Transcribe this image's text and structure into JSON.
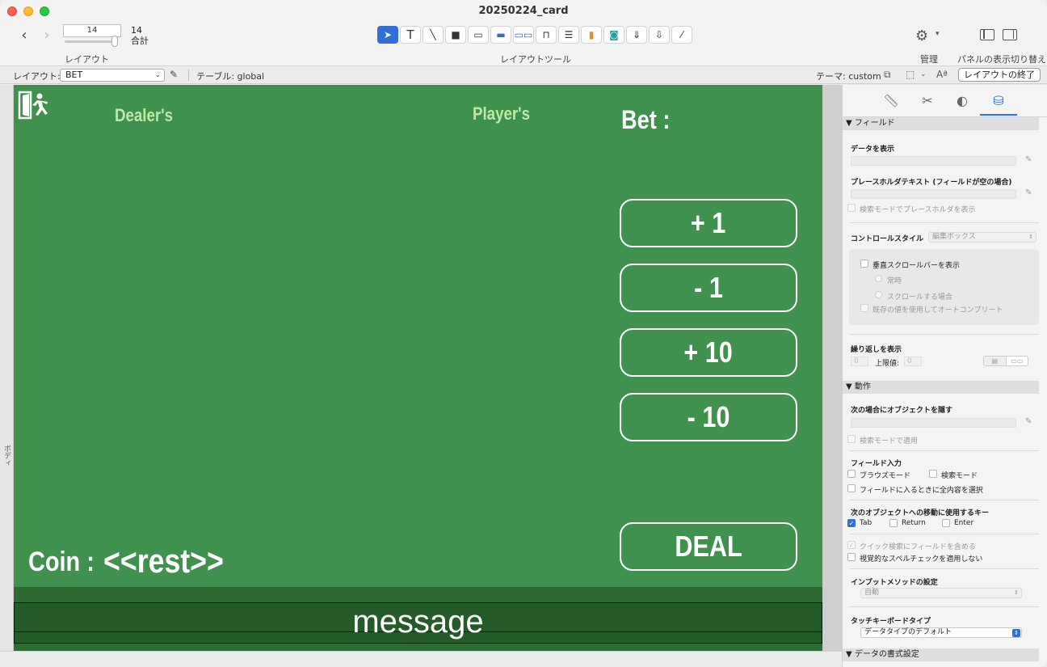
{
  "window": {
    "title": "20250224_card"
  },
  "toolbar": {
    "record_value": "14",
    "record_count": "14",
    "record_total_label": "合計",
    "layout_label": "レイアウト",
    "tools_label": "レイアウトツール",
    "manage_label": "管理",
    "panel_label": "パネルの表示切り替え"
  },
  "layoutbar": {
    "layout_prefix": "レイアウト:",
    "layout_value": "BET",
    "table": "テーブル: global",
    "theme": "テーマ: custom",
    "exit_label": "レイアウトの終了"
  },
  "canvas": {
    "part_label": "ボディ",
    "dealer": "Dealer's",
    "player": "Player's",
    "bet": "Bet :",
    "coin": "Coin :",
    "rest": "<<rest>>",
    "buttons": [
      "+ 1",
      "- 1",
      "+ 10",
      "- 10",
      "DEAL"
    ],
    "message": "message",
    "green_color": "#40904e"
  },
  "inspector": {
    "field_header": "▼ フィールド",
    "data_display": "データを表示",
    "placeholder_text": "プレースホルダテキスト (フィールドが空の場合)",
    "placeholder_find": "検索モードでプレースホルダを表示",
    "control_style": "コントロールスタイル",
    "control_style_value": "編集ボックス",
    "vscroll": "垂直スクロールバーを表示",
    "always": "常時",
    "when_scrolling": "スクロールする場合",
    "autocomplete": "既存の値を使用してオートコンプリート",
    "repeat_show": "繰り返しを表示",
    "repeat_from": "0",
    "upper_label": "上限値:",
    "upper_value": "0",
    "behavior_header": "▼ 動作",
    "hide_object": "次の場合にオブジェクトを隠す",
    "apply_find": "検索モードで適用",
    "field_entry": "フィールド入力",
    "browse_mode": "ブラウズモード",
    "find_mode": "検索モード",
    "select_all": "フィールドに入るときに全内容を選択",
    "next_key": "次のオブジェクトへの移動に使用するキー",
    "key_tab": "Tab",
    "key_return": "Return",
    "key_enter": "Enter",
    "quick_find": "クイック検索にフィールドを含める",
    "spell_check": "視覚的なスペルチェックを適用しない",
    "input_method": "インプットメソッドの設定",
    "input_method_value": "自動",
    "touch_kbd": "タッチキーボードタイプ",
    "touch_kbd_value": "データタイプのデフォルト",
    "format_header": "▼ データの書式設定"
  }
}
